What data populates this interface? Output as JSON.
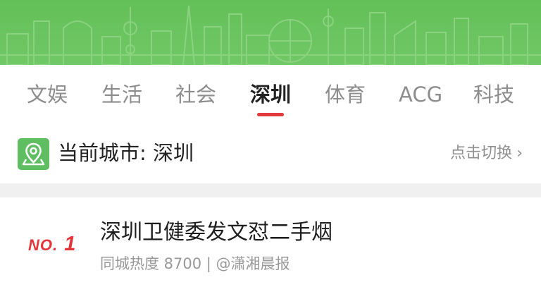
{
  "theme": {
    "banner_green": "#63bf58",
    "accent_red": "#e4393c",
    "location_green": "#5fbe62"
  },
  "tabs": [
    {
      "label": "文娱",
      "active": false
    },
    {
      "label": "生活",
      "active": false
    },
    {
      "label": "社会",
      "active": false
    },
    {
      "label": "深圳",
      "active": true
    },
    {
      "label": "体育",
      "active": false
    },
    {
      "label": "ACG",
      "active": false
    },
    {
      "label": "科技",
      "active": false
    }
  ],
  "city": {
    "icon": "location-pin-icon",
    "label": "当前城市: 深圳",
    "switch_label": "点击切换",
    "switch_icon": "chevron-right-icon"
  },
  "news": [
    {
      "rank_prefix": "NO.",
      "rank": "1",
      "title": "深圳卫健委发文怼二手烟",
      "meta": "同城热度 8700 | @潇湘晨报"
    }
  ]
}
